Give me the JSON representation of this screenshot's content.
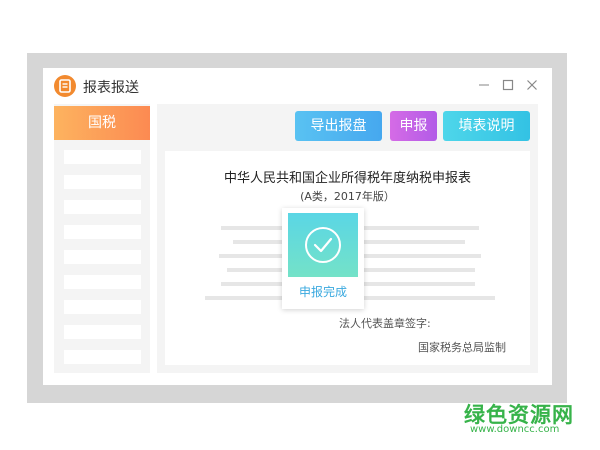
{
  "window": {
    "title": "报表报送",
    "controls": [
      "minimize-icon",
      "maximize-icon",
      "close-icon"
    ]
  },
  "sidebar": {
    "active_tab": "国税",
    "placeholder_rows": 9
  },
  "toolbar": {
    "export_label": "导出报盘",
    "declare_label": "申报",
    "guide_label": "填表说明"
  },
  "document": {
    "title": "中华人民共和国企业所得税年度纳税申报表",
    "subtitle": "(A类，2017年版）",
    "signature_label": "法人代表盖章签字:",
    "supervisor": "国家税务总局监制"
  },
  "status_card": {
    "icon": "check-circle-icon",
    "label": "申报完成"
  },
  "watermark": {
    "title": "绿色资源网",
    "url": "www.downcc.com"
  },
  "colors": {
    "sidebar_tab": "#fc8a52",
    "export_button": "#46a8ef",
    "declare_button": "#b25be7",
    "guide_button": "#33c2e4",
    "status_card": "#5ad6e5",
    "watermark": "#37b34a"
  }
}
